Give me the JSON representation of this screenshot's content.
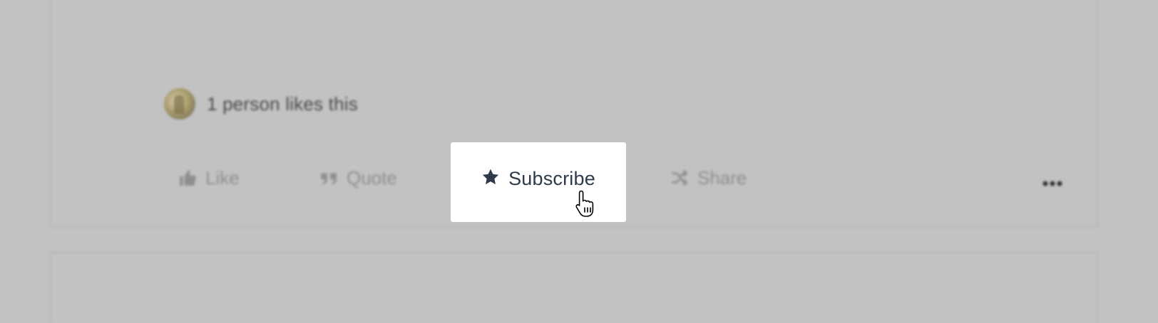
{
  "post": {
    "likes_text": "1 person likes this",
    "actions": {
      "like": "Like",
      "quote": "Quote",
      "subscribe": "Subscribe",
      "share": "Share"
    }
  },
  "icons": {
    "like": "thumbs-up-icon",
    "quote": "quote-icon",
    "subscribe": "star-icon",
    "share": "shuffle-icon",
    "more": "ellipsis-icon"
  },
  "colors": {
    "overlay_background": "#c2c2c2",
    "highlight_background": "#ffffff",
    "subscribe_text": "#2f3b4c"
  }
}
